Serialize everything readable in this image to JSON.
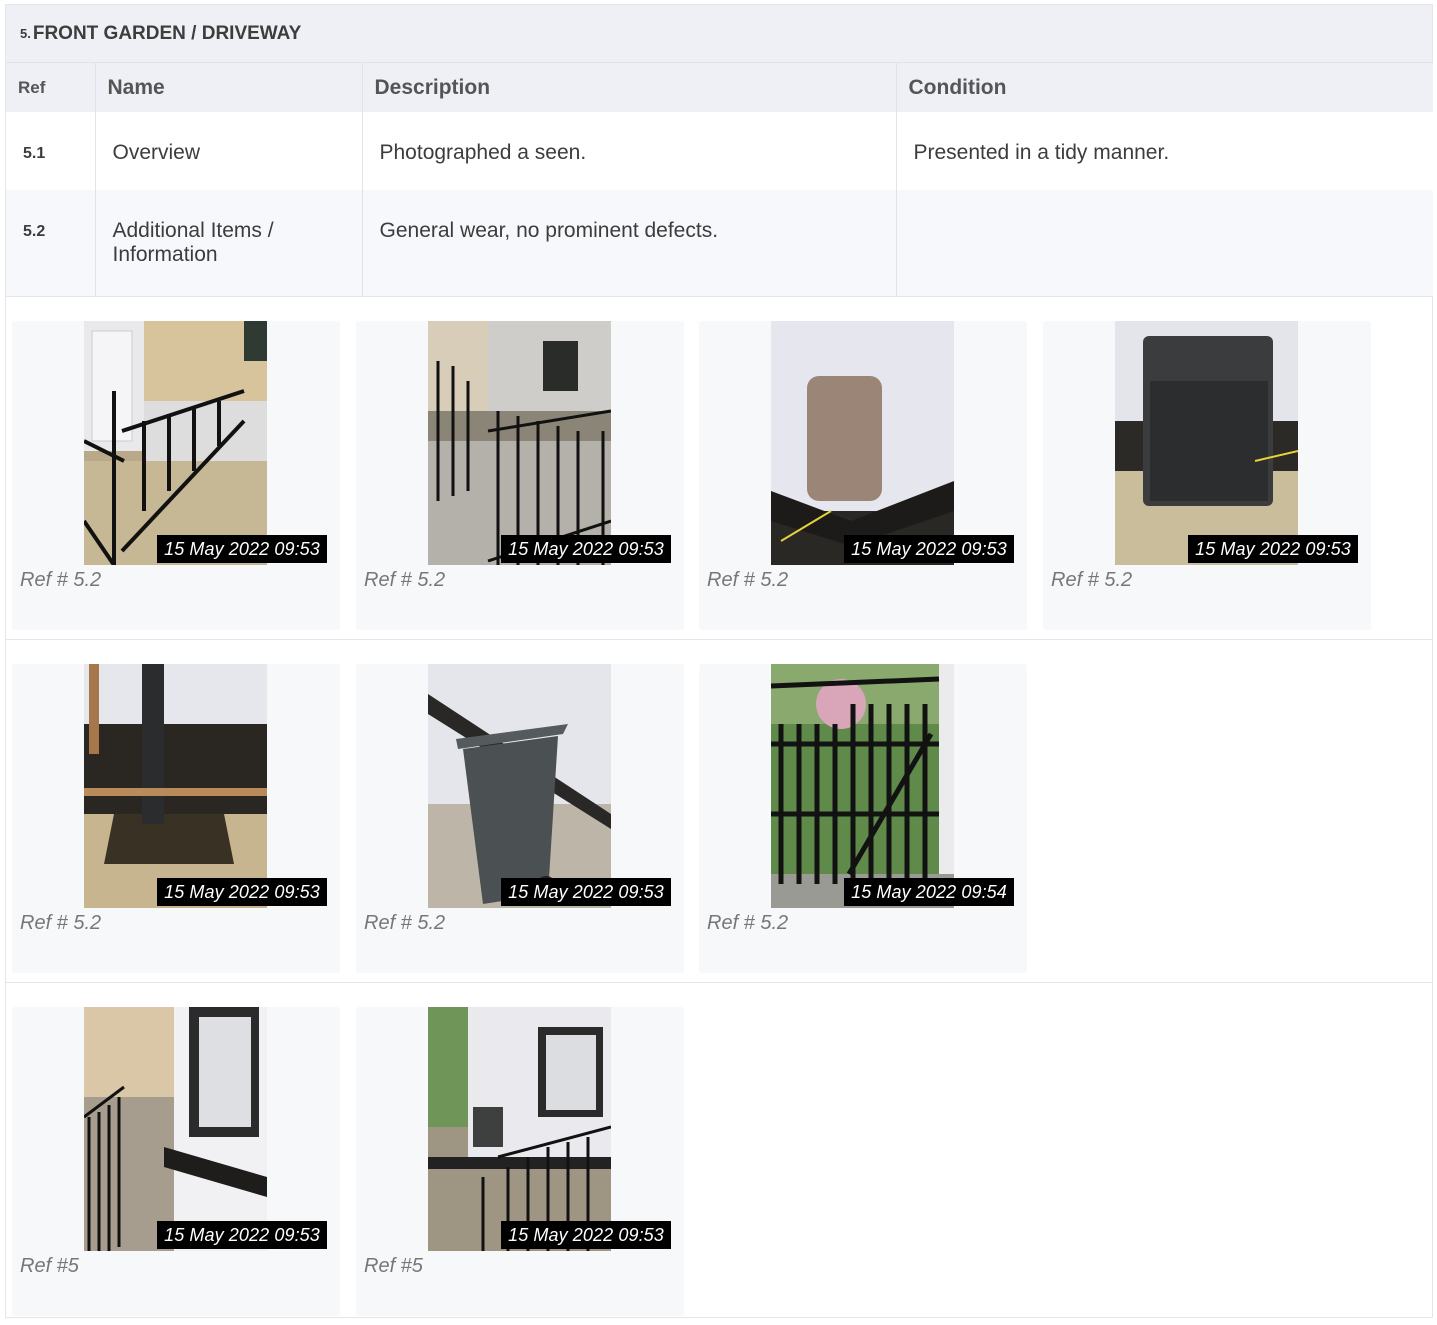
{
  "section": {
    "number": "5.",
    "title": "FRONT GARDEN / DRIVEWAY"
  },
  "table": {
    "headers": {
      "ref": "Ref",
      "name": "Name",
      "description": "Description",
      "condition": "Condition"
    },
    "rows": [
      {
        "ref": "5.1",
        "name": "Overview",
        "description": "Photographed a seen.",
        "condition": "Presented in a tidy manner."
      },
      {
        "ref": "5.2",
        "name": "Additional Items / Information",
        "description": "General wear, no prominent defects.",
        "condition": ""
      }
    ]
  },
  "photos": [
    {
      "timestamp": "15 May 2022 09:53",
      "caption": "Ref # 5.2",
      "subject": "railing-gate"
    },
    {
      "timestamp": "15 May 2022 09:53",
      "caption": "Ref # 5.2",
      "subject": "railing-bin"
    },
    {
      "timestamp": "15 May 2022 09:53",
      "caption": "Ref # 5.2",
      "subject": "meter-box-cover"
    },
    {
      "timestamp": "15 May 2022 09:53",
      "caption": "Ref # 5.2",
      "subject": "meter-box"
    },
    {
      "timestamp": "15 May 2022 09:53",
      "caption": "Ref # 5.2",
      "subject": "downpipe"
    },
    {
      "timestamp": "15 May 2022 09:53",
      "caption": "Ref # 5.2",
      "subject": "wheelie-bin"
    },
    {
      "timestamp": "15 May 2022 09:54",
      "caption": "Ref # 5.2",
      "subject": "side-gate"
    },
    {
      "timestamp": "15 May 2022 09:53",
      "caption": "Ref #5",
      "subject": "path-window"
    },
    {
      "timestamp": "15 May 2022 09:53",
      "caption": "Ref #5",
      "subject": "house-front"
    }
  ]
}
